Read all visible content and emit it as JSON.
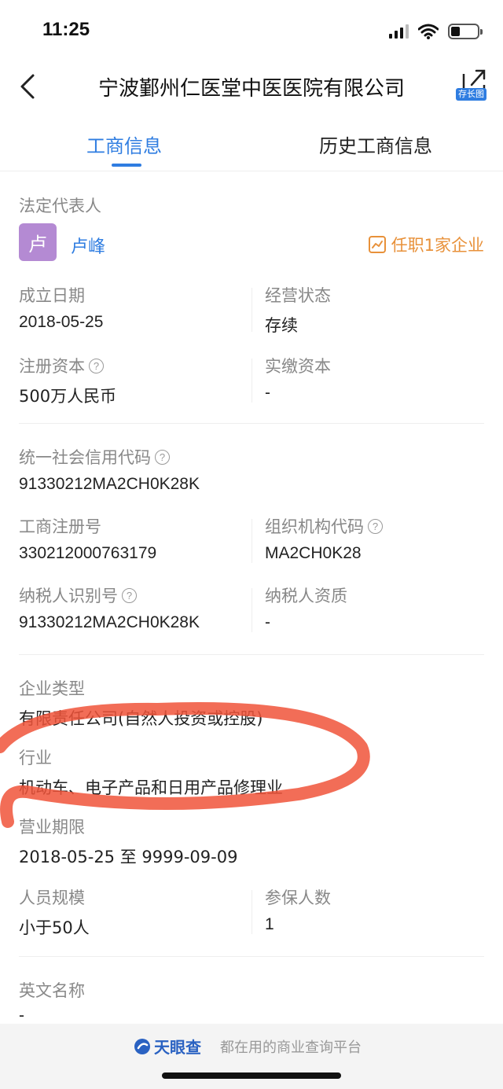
{
  "status_bar": {
    "time": "11:25"
  },
  "nav": {
    "title": "宁波鄞州仁医堂中医医院有限公司",
    "share_badge": "存长图"
  },
  "tabs": [
    {
      "label": "工商信息",
      "active": true
    },
    {
      "label": "历史工商信息",
      "active": false
    }
  ],
  "legal_rep": {
    "label": "法定代表人",
    "avatar_char": "卢",
    "name": "卢峰",
    "positions": "任职1家企业"
  },
  "fields": {
    "established_date": {
      "label": "成立日期",
      "value": "2018-05-25"
    },
    "business_status": {
      "label": "经营状态",
      "value": "存续"
    },
    "registered_capital": {
      "label": "注册资本",
      "value": "500万人民币"
    },
    "paid_in_capital": {
      "label": "实缴资本",
      "value": "-"
    },
    "credit_code": {
      "label": "统一社会信用代码",
      "value": "91330212MA2CH0K28K"
    },
    "reg_number": {
      "label": "工商注册号",
      "value": "330212000763179"
    },
    "org_code": {
      "label": "组织机构代码",
      "value": "MA2CH0K28"
    },
    "taxpayer_id": {
      "label": "纳税人识别号",
      "value": "91330212MA2CH0K28K"
    },
    "taxpayer_qual": {
      "label": "纳税人资质",
      "value": "-"
    },
    "company_type": {
      "label": "企业类型",
      "value": "有限责任公司(自然人投资或控股)"
    },
    "industry": {
      "label": "行业",
      "value": "机动车、电子产品和日用产品修理业"
    },
    "business_term": {
      "label": "营业期限",
      "value": "2018-05-25 至 9999-09-09"
    },
    "staff_size": {
      "label": "人员规模",
      "value": "小于50人"
    },
    "insured_count": {
      "label": "参保人数",
      "value": "1"
    },
    "english_name": {
      "label": "英文名称",
      "value": "-"
    }
  },
  "footer": {
    "brand": "天眼查",
    "slogan": "都在用的商业查询平台"
  },
  "colors": {
    "accent": "#2f7de1",
    "orange": "#e8913a",
    "avatar": "#b48ad3",
    "annotation": "#f0533a"
  }
}
